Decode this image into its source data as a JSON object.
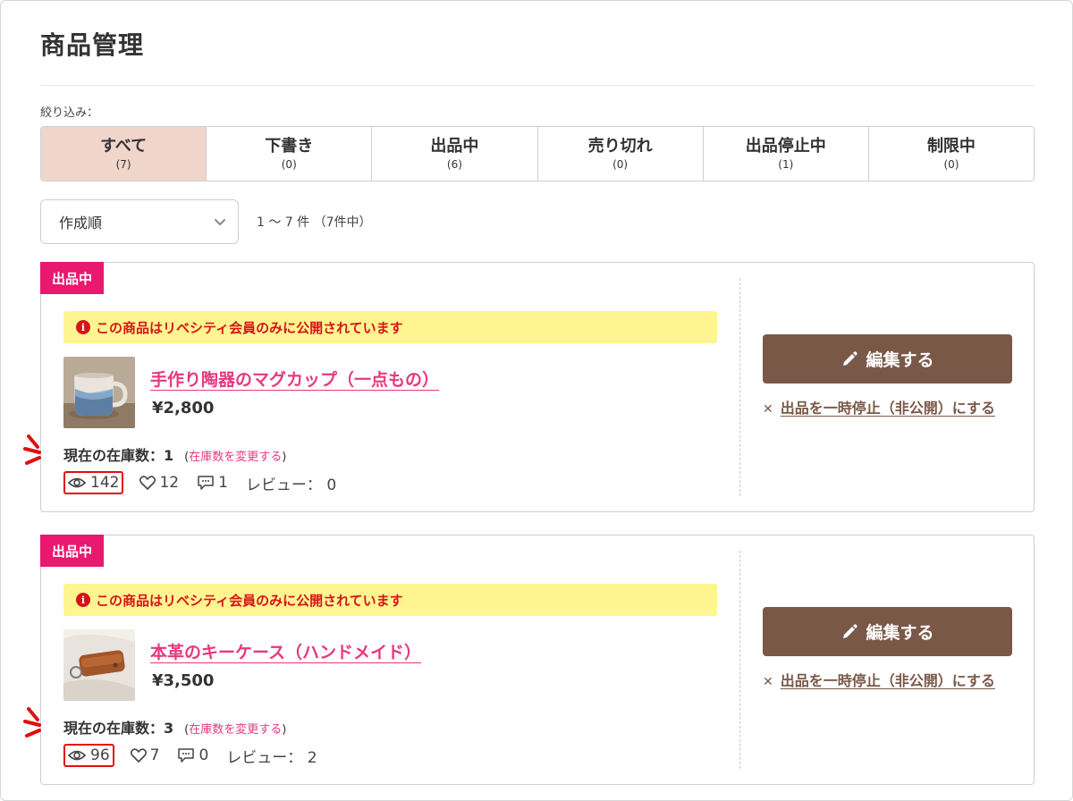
{
  "page": {
    "title": "商品管理",
    "filter_label": "絞り込み："
  },
  "tabs": [
    {
      "label": "すべて",
      "count": "(7)",
      "active": true
    },
    {
      "label": "下書き",
      "count": "(0)"
    },
    {
      "label": "出品中",
      "count": "(6)"
    },
    {
      "label": "売り切れ",
      "count": "(0)"
    },
    {
      "label": "出品停止中",
      "count": "(1)"
    },
    {
      "label": "制限中",
      "count": "(0)"
    }
  ],
  "sort": {
    "selected": "作成順"
  },
  "result_count": "1 〜 7 件 （7件中）",
  "products": [
    {
      "status": "出品中",
      "notice": "この商品はリベシティ会員のみに公開されています",
      "name": "手作り陶器のマグカップ（一点もの）",
      "price": "¥2,800",
      "stock_label": "現在の在庫数：1",
      "stock_change": "在庫数を変更する",
      "views": "142",
      "likes": "12",
      "comments": "1",
      "reviews": "レビュー： 0",
      "edit_label": "編集する",
      "pause_label": "出品を一時停止（非公開）にする"
    },
    {
      "status": "出品中",
      "notice": "この商品はリベシティ会員のみに公開されています",
      "name": "本革のキーケース（ハンドメイド）",
      "price": "¥3,500",
      "stock_label": "現在の在庫数：3",
      "stock_change": "在庫数を変更する",
      "views": "96",
      "likes": "7",
      "comments": "0",
      "reviews": "レビュー： 2",
      "edit_label": "編集する",
      "pause_label": "出品を一時停止（非公開）にする"
    }
  ],
  "colors": {
    "accent_pink": "#e8196e",
    "edit_brown": "#7a5848",
    "active_tab": "#f0d5cb",
    "notice_yellow": "#fff590",
    "alert_red": "#d8141a"
  }
}
